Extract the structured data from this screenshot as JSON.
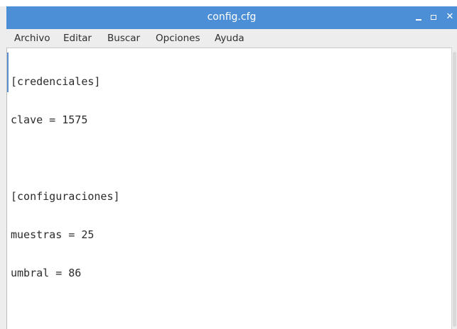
{
  "window": {
    "title": "config.cfg",
    "controls": {
      "minimize": "–",
      "maximize": "□",
      "close": "✕"
    }
  },
  "menubar": {
    "items": [
      {
        "label": "Archivo"
      },
      {
        "label": "Editar"
      },
      {
        "label": "Buscar"
      },
      {
        "label": "Opciones"
      },
      {
        "label": "Ayuda"
      }
    ]
  },
  "editor": {
    "lines": [
      "[credenciales]",
      "clave = 1575",
      "",
      "[configuraciones]",
      "muestras = 25",
      "umbral = 86"
    ]
  },
  "colors": {
    "titlebar": "#4d8fd6",
    "menubar": "#ededed",
    "editor_bg": "#ffffff",
    "text": "#2b2b2b"
  },
  "icons": {
    "minimize": "minimize-icon",
    "maximize": "maximize-icon",
    "close": "close-icon"
  }
}
